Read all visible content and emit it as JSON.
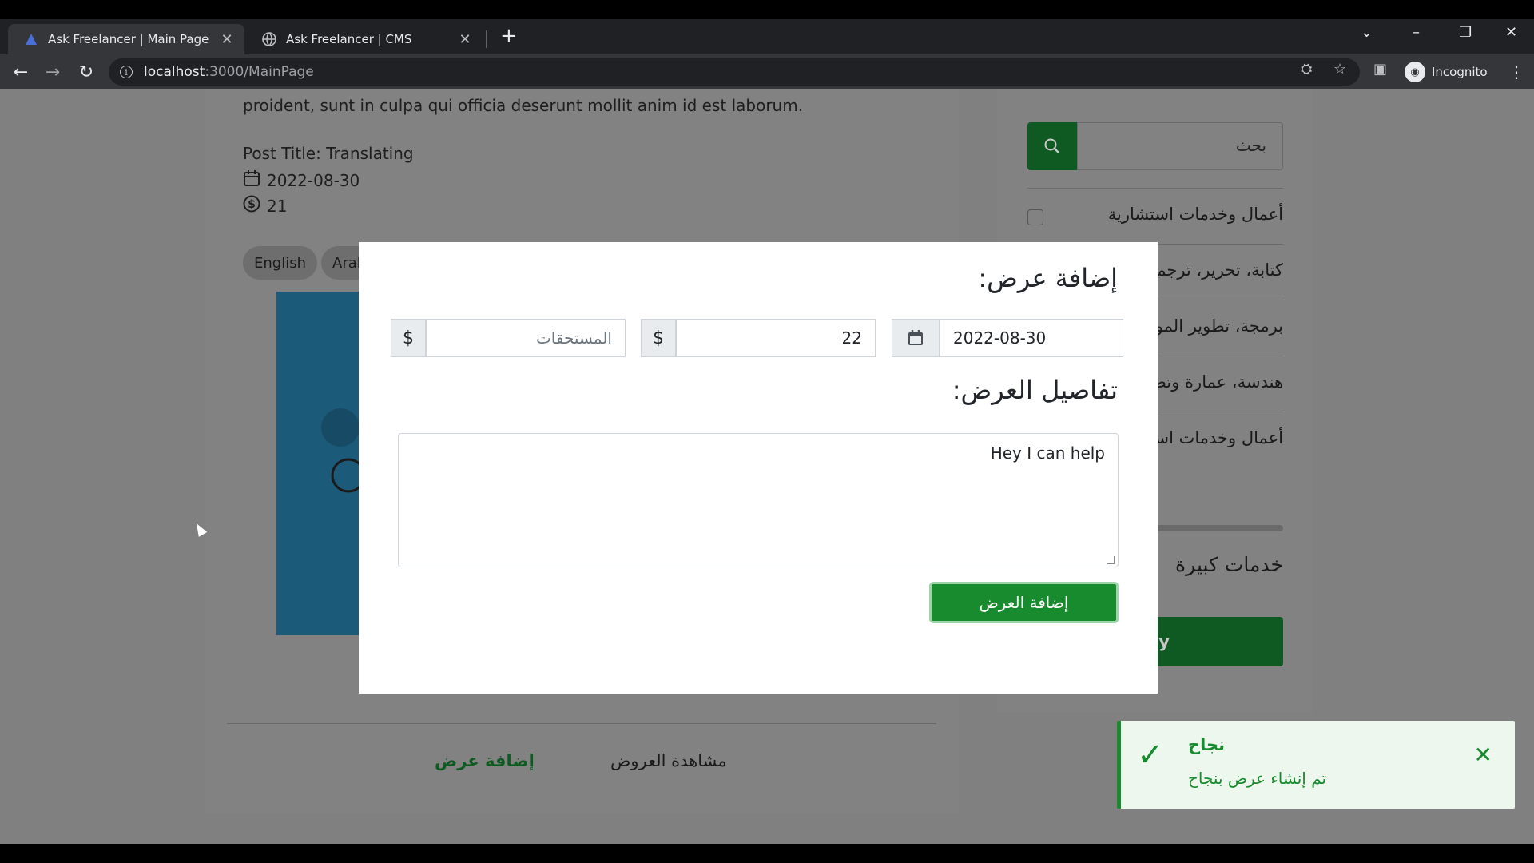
{
  "browser": {
    "tabs": [
      {
        "title": "Ask Freelancer | Main Page",
        "active": true
      },
      {
        "title": "Ask Freelancer | CMS",
        "active": false
      }
    ],
    "url_host": "localhost",
    "url_path": ":3000/MainPage",
    "incognito_label": "Incognito"
  },
  "post": {
    "body_tail": "proident, sunt in culpa qui officia deserunt mollit anim id est laborum.",
    "title": "Post Title: Translating",
    "date": "2022-08-30",
    "price": "21",
    "tags": [
      "English",
      "Arab"
    ],
    "view_offers": "مشاهدة العروض",
    "add_offer_link": "إضافة عرض"
  },
  "sidebar": {
    "search_placeholder": "بحث",
    "categories": [
      "أعمال وخدمات استشارية",
      "كتابة، تحرير، ترجمة و",
      "برمجة، تطوير المواقع",
      "هندسة، عمارة وتصميم",
      "أعمال وخدمات استشا"
    ],
    "big_services": "خدمات كبيرة",
    "apply": "ply"
  },
  "modal": {
    "title": "إضافة عرض:",
    "date_value": "2022-08-30",
    "amount_value": "22",
    "dues_placeholder": "المستحقات",
    "currency_symbol": "$",
    "details_title": "تفاصيل العرض:",
    "details_value": "Hey I can help",
    "submit": "إضافة العرض"
  },
  "toast": {
    "title": "نجاح",
    "message": "تم إنشاء عرض بنجاح"
  },
  "colors": {
    "success": "#198b2f",
    "overlay": "#808080"
  }
}
